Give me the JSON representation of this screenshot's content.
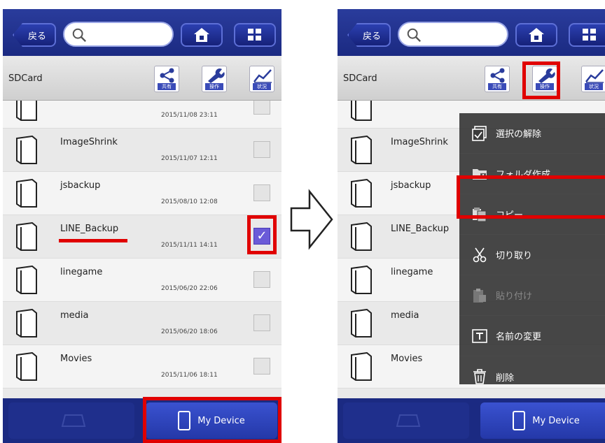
{
  "topbar": {
    "back_label": "戻る"
  },
  "toolbar": {
    "path": "SDCard",
    "share_label": "共有",
    "ops_label": "操作",
    "status_label": "状況"
  },
  "files_left": [
    {
      "name": "",
      "date": "2015/11/08 23:11",
      "checked": false
    },
    {
      "name": "ImageShrink",
      "date": "2015/11/07 12:11",
      "checked": false
    },
    {
      "name": "jsbackup",
      "date": "2015/08/10 12:08",
      "checked": false
    },
    {
      "name": "LINE_Backup",
      "date": "2015/11/11 14:11",
      "checked": true
    },
    {
      "name": "linegame",
      "date": "2015/06/20 22:06",
      "checked": false
    },
    {
      "name": "media",
      "date": "2015/06/20 18:06",
      "checked": false
    },
    {
      "name": "Movies",
      "date": "2015/11/06 18:11",
      "checked": false
    }
  ],
  "files_right": [
    {
      "name": ""
    },
    {
      "name": "ImageShrink"
    },
    {
      "name": "jsbackup"
    },
    {
      "name": "LINE_Backup"
    },
    {
      "name": "linegame"
    },
    {
      "name": "media"
    },
    {
      "name": "Movies"
    }
  ],
  "bottom": {
    "inactive_tab": "",
    "active_tab": "My Device"
  },
  "menu": {
    "items": [
      {
        "label": "選択の解除",
        "icon": "deselect-icon",
        "enabled": true
      },
      {
        "label": "フォルダ作成",
        "icon": "new-folder-icon",
        "enabled": true
      },
      {
        "label": "コピー",
        "icon": "copy-icon",
        "enabled": true
      },
      {
        "label": "切り取り",
        "icon": "scissors-icon",
        "enabled": true
      },
      {
        "label": "貼り付け",
        "icon": "paste-icon",
        "enabled": false
      },
      {
        "label": "名前の変更",
        "icon": "rename-icon",
        "enabled": true
      },
      {
        "label": "削除",
        "icon": "trash-icon",
        "enabled": true
      }
    ]
  },
  "colors": {
    "brand": "#1b2a82",
    "highlight": "#e00000",
    "checked": "#6a5bd8"
  }
}
